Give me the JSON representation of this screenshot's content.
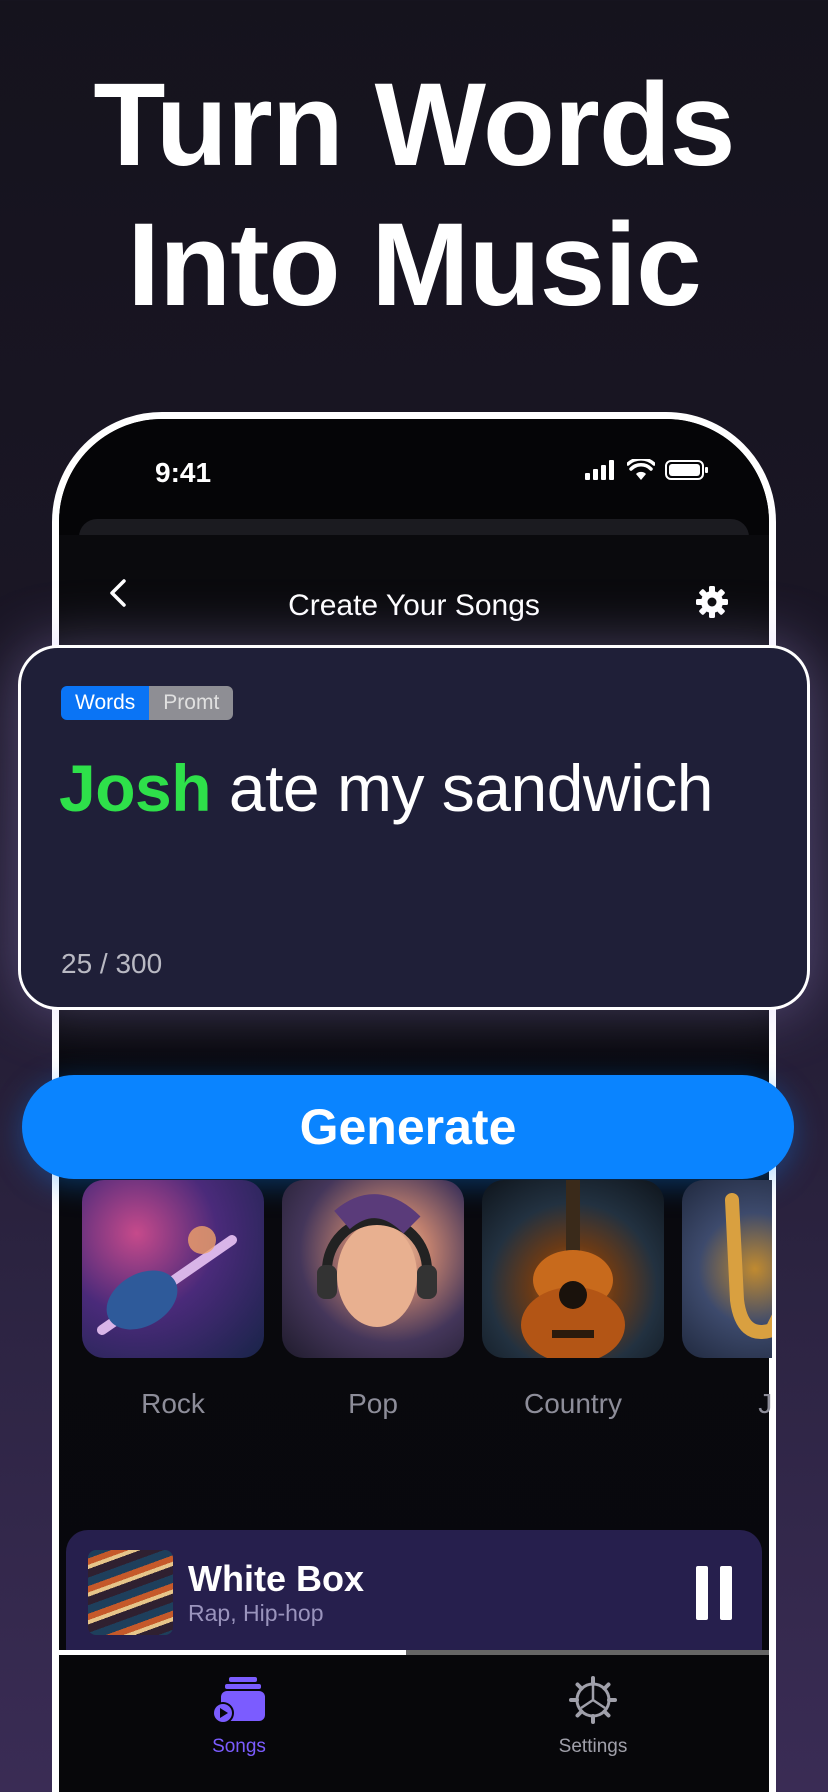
{
  "headline": {
    "line1": "Turn Words",
    "line2": "Into Music"
  },
  "status_bar": {
    "time": "9:41"
  },
  "navbar": {
    "title": "Create Your Songs"
  },
  "editor": {
    "mode_words": "Words",
    "mode_prompt": "Promt",
    "highlight_word": "Josh",
    "rest_text": " ate my sandwich",
    "counter": "25 / 300"
  },
  "generate": {
    "label": "Generate"
  },
  "genres": [
    {
      "label": "Rock"
    },
    {
      "label": "Pop"
    },
    {
      "label": "Country"
    },
    {
      "label": "Ja"
    }
  ],
  "player": {
    "title": "White Box",
    "subtitle": "Rap, Hip-hop",
    "progress": 0.49
  },
  "tabbar": {
    "songs": "Songs",
    "settings": "Settings"
  },
  "colors": {
    "accent_blue": "#0a84ff",
    "highlight_green": "#2ee04a",
    "tab_active": "#7b5cff",
    "player_bg": "#261f4d"
  }
}
